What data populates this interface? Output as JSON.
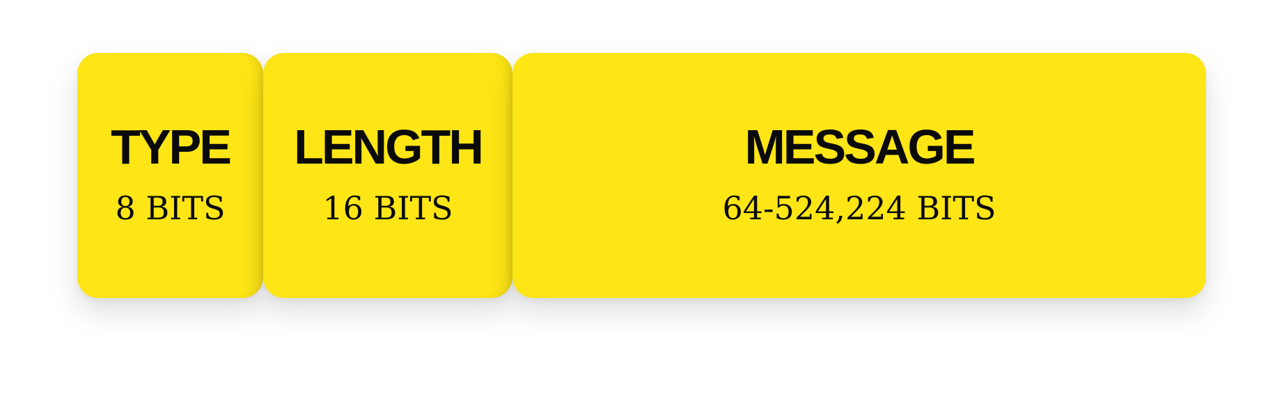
{
  "colors": {
    "field_fill": "#FDE516",
    "text": "#0a0a0a",
    "background": "#ffffff"
  },
  "fields": [
    {
      "name": "TYPE",
      "size": "8 BITS"
    },
    {
      "name": "LENGTH",
      "size": "16 BITS"
    },
    {
      "name": "MESSAGE",
      "size": "64-524,224 BITS"
    }
  ]
}
